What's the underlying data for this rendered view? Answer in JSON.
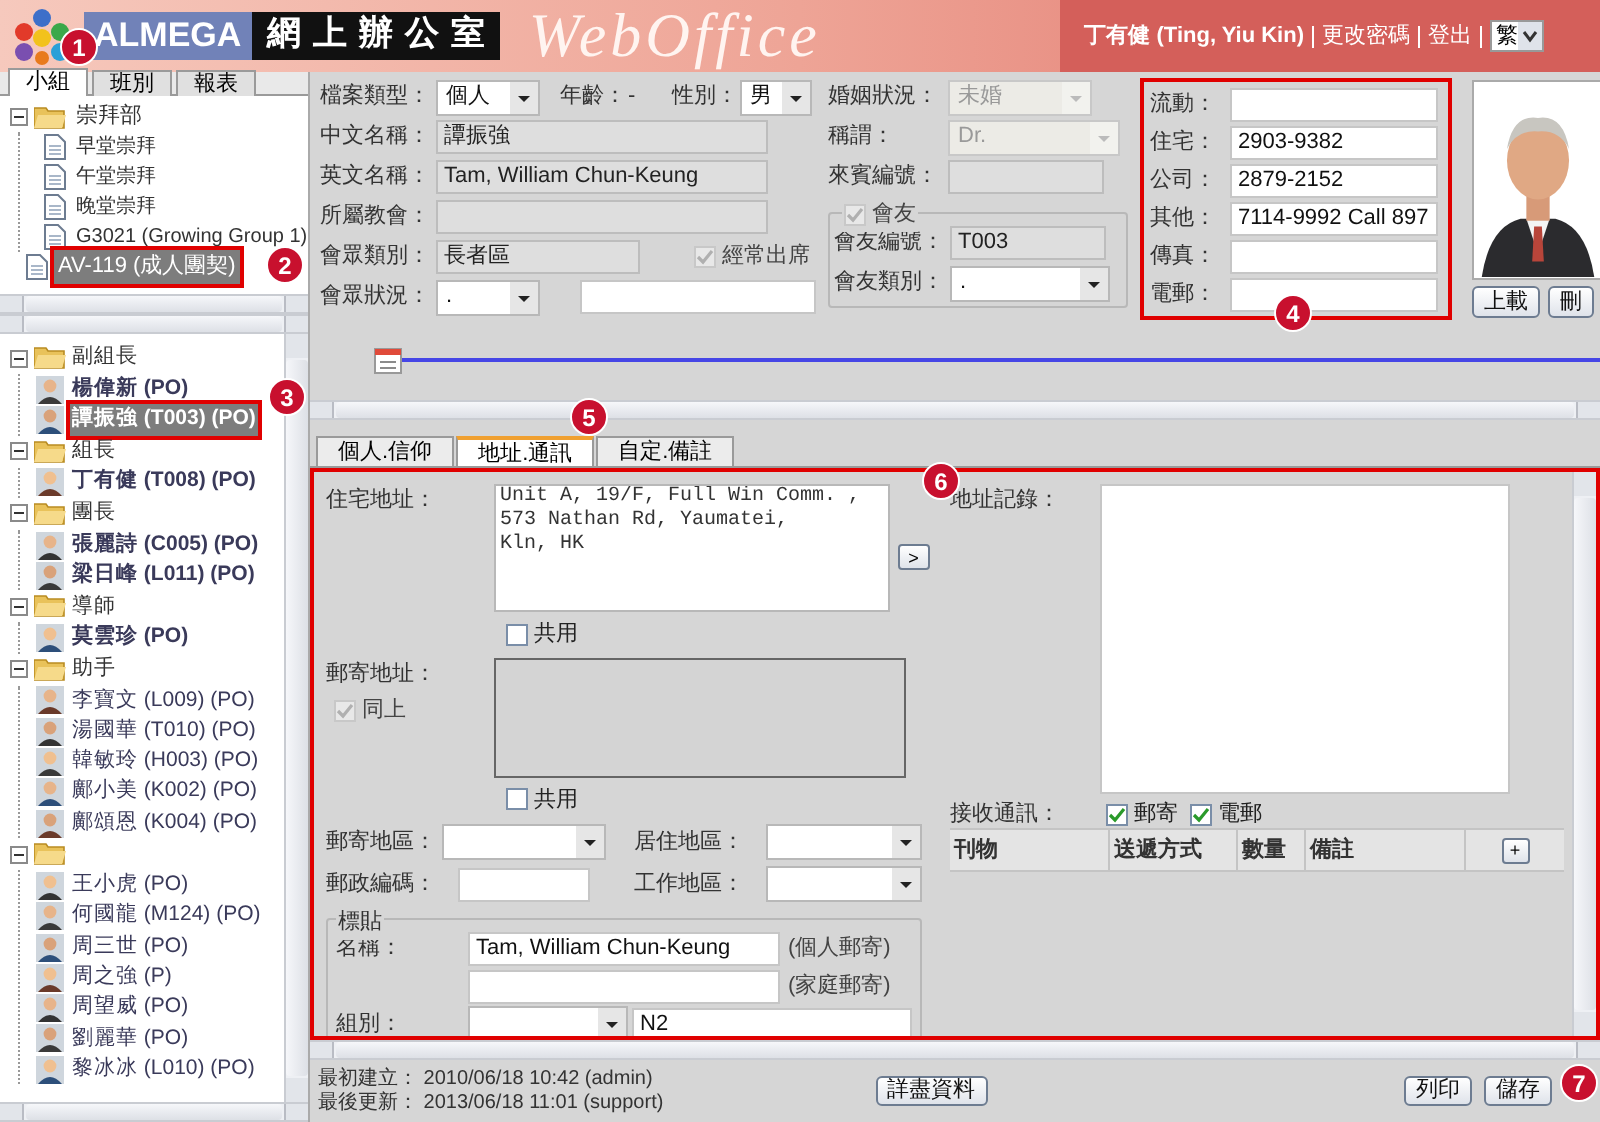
{
  "header": {
    "brand": "ALMEGA",
    "title": "網 上 辦 公 室",
    "product": "WebOffice",
    "user": "丁有健 (Ting, Yiu Kin)",
    "links": [
      "更改密碼",
      "登出"
    ],
    "language": "繁"
  },
  "sidebar": {
    "tabs": [
      {
        "label": "小組",
        "selected": true
      },
      {
        "label": "班別",
        "selected": false
      },
      {
        "label": "報表",
        "selected": false
      }
    ],
    "groups_tree": [
      {
        "label": "崇拜部",
        "kind": "folder",
        "children": [
          {
            "label": "早堂崇拜",
            "kind": "doc",
            "selected": false
          },
          {
            "label": "午堂崇拜",
            "kind": "doc",
            "selected": false
          },
          {
            "label": "晚堂崇拜",
            "kind": "doc",
            "selected": false
          },
          {
            "label": "G3021 (Growing Group 1)",
            "kind": "doc",
            "selected": false
          }
        ]
      },
      {
        "label": "AV-119 (成人團契)",
        "kind": "doc",
        "selected": true,
        "outlined": true
      }
    ],
    "members_tree": [
      {
        "label": "副組長",
        "children": [
          {
            "name": "楊偉新 (PO)",
            "bold": true,
            "selected": false
          },
          {
            "name": "譚振強 (T003) (PO)",
            "bold": true,
            "selected": true,
            "outlined": true
          }
        ]
      },
      {
        "label": "組長",
        "children": [
          {
            "name": "丁有健 (T008) (PO)",
            "bold": true,
            "selected": false
          }
        ]
      },
      {
        "label": "團長",
        "children": [
          {
            "name": "張麗詩 (C005) (PO)",
            "bold": true,
            "selected": false
          },
          {
            "name": "梁日峰 (L011) (PO)",
            "bold": true,
            "selected": false
          }
        ]
      },
      {
        "label": "導師",
        "children": [
          {
            "name": "莫雲珍 (PO)",
            "bold": true,
            "selected": false
          }
        ]
      },
      {
        "label": "助手",
        "children": [
          {
            "name": "李寶文 (L009) (PO)",
            "bold": false,
            "selected": false
          },
          {
            "name": "湯國華 (T010) (PO)",
            "bold": false,
            "selected": false
          },
          {
            "name": "韓敏玲 (H003) (PO)",
            "bold": false,
            "selected": false
          },
          {
            "name": "鄺小美 (K002) (PO)",
            "bold": false,
            "selected": false
          },
          {
            "name": "鄺頌恩 (K004) (PO)",
            "bold": false,
            "selected": false
          }
        ]
      },
      {
        "children": [
          {
            "name": "王小虎 (PO)",
            "bold": false,
            "selected": false
          },
          {
            "name": "何國龍 (M124) (PO)",
            "bold": false,
            "selected": false
          },
          {
            "name": "周三世 (PO)",
            "bold": false,
            "selected": false
          },
          {
            "name": "周之強 (P)",
            "bold": false,
            "selected": false
          },
          {
            "name": "周望威 (PO)",
            "bold": false,
            "selected": false
          },
          {
            "name": "劉麗華 (PO)",
            "bold": false,
            "selected": false
          },
          {
            "name": "黎冰冰 (L010) (PO)",
            "bold": false,
            "selected": false
          }
        ]
      }
    ]
  },
  "profile": {
    "record_type": {
      "label": "檔案類型：",
      "value": "個人"
    },
    "age": {
      "label": "年齡：",
      "value": "-"
    },
    "gender": {
      "label": "性別：",
      "value": "男"
    },
    "marital": {
      "label": "婚姻狀況：",
      "value": "未婚",
      "disabled": true
    },
    "chinese_name": {
      "label": "中文名稱：",
      "value": "譚振強"
    },
    "title": {
      "label": "稱謂：",
      "value": "Dr.",
      "disabled": true
    },
    "english_name": {
      "label": "英文名稱：",
      "value": "Tam, William Chun-Keung"
    },
    "guest_no": {
      "label": "來賓編號："
    },
    "church": {
      "label": "所屬教會："
    },
    "member": {
      "label": "會友",
      "checked": true,
      "disabled": true
    },
    "congregation_type": {
      "label": "會眾類別：",
      "value": "長者區"
    },
    "regular": {
      "label": "經常出席",
      "checked": true,
      "disabled": true
    },
    "member_no": {
      "label": "會友編號：",
      "value": "T003"
    },
    "congregation_status": {
      "label": "會眾狀況：",
      "value": "."
    },
    "member_type": {
      "label": "會友類別：",
      "value": "."
    }
  },
  "contacts": {
    "outlined": true,
    "items": [
      {
        "label": "流動："
      },
      {
        "label": "住宅：",
        "value": "2903-9382"
      },
      {
        "label": "公司：",
        "value": "2879-2152"
      },
      {
        "label": "其他：",
        "value": "7114-9992 Call 897"
      },
      {
        "label": "傳真："
      },
      {
        "label": "電郵："
      }
    ]
  },
  "photo": {
    "kind": "picture",
    "buttons": [
      "上載",
      "刪"
    ]
  },
  "detail_tabs": [
    {
      "label": "個人.信仰",
      "selected": false
    },
    {
      "label": "地址.通訊",
      "selected": true
    },
    {
      "label": "自定.備註",
      "selected": false
    }
  ],
  "address_panel": {
    "outlined": true,
    "home_address": {
      "label": "住宅地址：",
      "value": "Unit A, 19/F, Full Win Comm. ,\n573 Nathan Rd, Yaumatei,\nKln, HK"
    },
    "copy_button": ">",
    "home_shared": {
      "label": "共用",
      "checked": false
    },
    "mail_address": {
      "label": "郵寄地址："
    },
    "same_as_above": {
      "label": "同上",
      "checked": true,
      "disabled": true
    },
    "mail_shared": {
      "label": "共用",
      "checked": false
    },
    "mail_region": {
      "label": "郵寄地區："
    },
    "residence_region": {
      "label": "居住地區："
    },
    "postcode": {
      "label": "郵政編碼："
    },
    "work_region": {
      "label": "工作地區："
    },
    "label_group": {
      "legend": "標貼",
      "name_label": "名稱：",
      "personal_name": "Tam, William Chun-Keung",
      "personal_note": "(個人郵寄)",
      "family_note": "(家庭郵寄)",
      "group_label": "組別：",
      "group_code": "N2"
    },
    "address_log": {
      "label": "地址記錄："
    },
    "receive": {
      "label": "接收通訊：",
      "options": [
        {
          "label": "郵寄",
          "checked": true
        },
        {
          "label": "電郵",
          "checked": true
        }
      ]
    },
    "table": {
      "columns": [
        "刊物",
        "送遞方式",
        "數量",
        "備註"
      ],
      "add_button": "+"
    }
  },
  "footer": {
    "created": "最初建立： 2010/06/18 10:42 (admin)",
    "updated": "最後更新： 2013/06/18 11:01 (support)",
    "buttons": [
      "詳盡資料",
      "列印",
      "儲存"
    ]
  },
  "callouts": [
    "1",
    "2",
    "3",
    "4",
    "5",
    "6",
    "7"
  ]
}
